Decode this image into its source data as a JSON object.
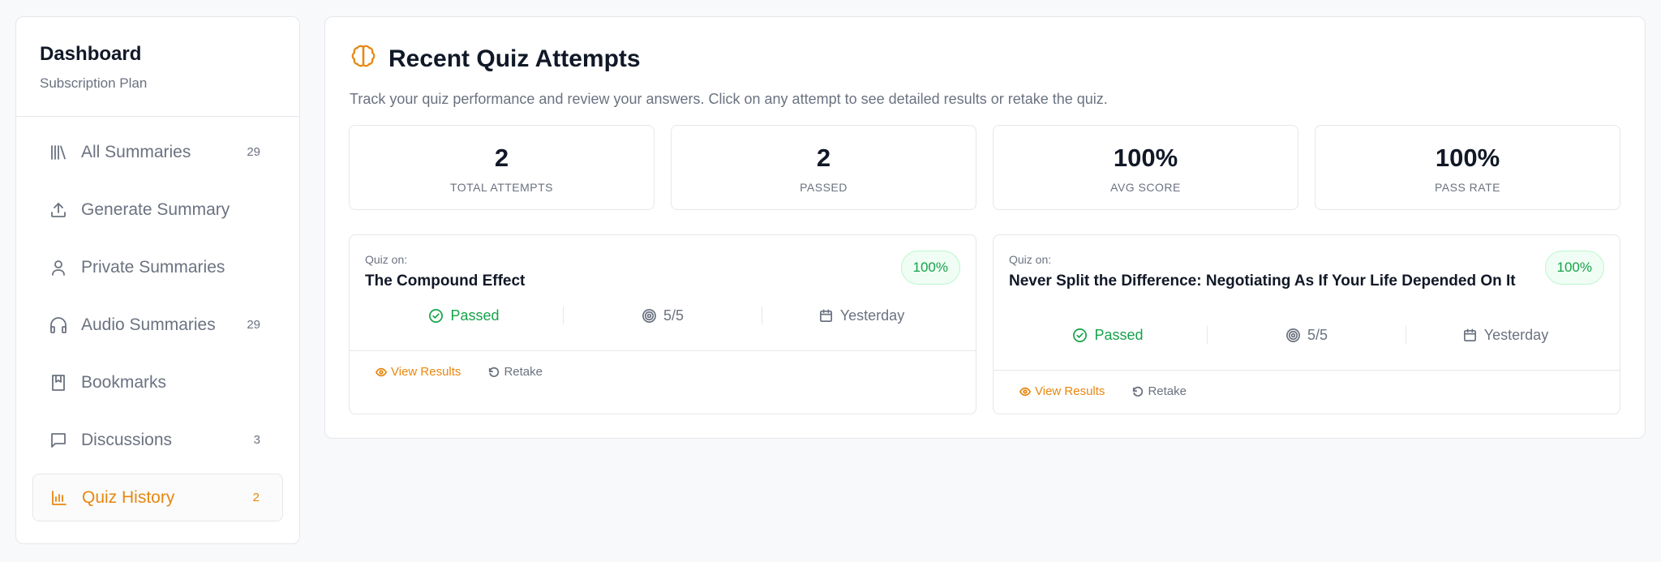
{
  "sidebar": {
    "title": "Dashboard",
    "subtitle": "Subscription Plan",
    "items": [
      {
        "label": "All Summaries",
        "count": "29",
        "icon": "library-icon"
      },
      {
        "label": "Generate Summary",
        "count": "",
        "icon": "upload-icon"
      },
      {
        "label": "Private Summaries",
        "count": "",
        "icon": "user-icon"
      },
      {
        "label": "Audio Summaries",
        "count": "29",
        "icon": "headphones-icon"
      },
      {
        "label": "Bookmarks",
        "count": "",
        "icon": "bookmark-icon"
      },
      {
        "label": "Discussions",
        "count": "3",
        "icon": "message-icon"
      },
      {
        "label": "Quiz History",
        "count": "2",
        "icon": "bar-chart-icon",
        "active": true
      }
    ]
  },
  "main": {
    "title": "Recent Quiz Attempts",
    "description": "Track your quiz performance and review your answers. Click on any attempt to see detailed results or retake the quiz.",
    "stats": [
      {
        "value": "2",
        "label": "TOTAL ATTEMPTS"
      },
      {
        "value": "2",
        "label": "PASSED"
      },
      {
        "value": "100%",
        "label": "AVG SCORE"
      },
      {
        "value": "100%",
        "label": "PASS RATE"
      }
    ],
    "attempts": [
      {
        "quiz_label": "Quiz on:",
        "title": "The Compound Effect",
        "percent": "100%",
        "status": "Passed",
        "score": "5/5",
        "date": "Yesterday",
        "view_label": "View Results",
        "retake_label": "Retake"
      },
      {
        "quiz_label": "Quiz on:",
        "title": "Never Split the Difference: Negotiating As If Your Life Depended On It",
        "percent": "100%",
        "status": "Passed",
        "score": "5/5",
        "date": "Yesterday",
        "view_label": "View Results",
        "retake_label": "Retake"
      }
    ]
  },
  "colors": {
    "accent": "#e7870f",
    "success": "#16a34a",
    "muted": "#6b7280"
  }
}
